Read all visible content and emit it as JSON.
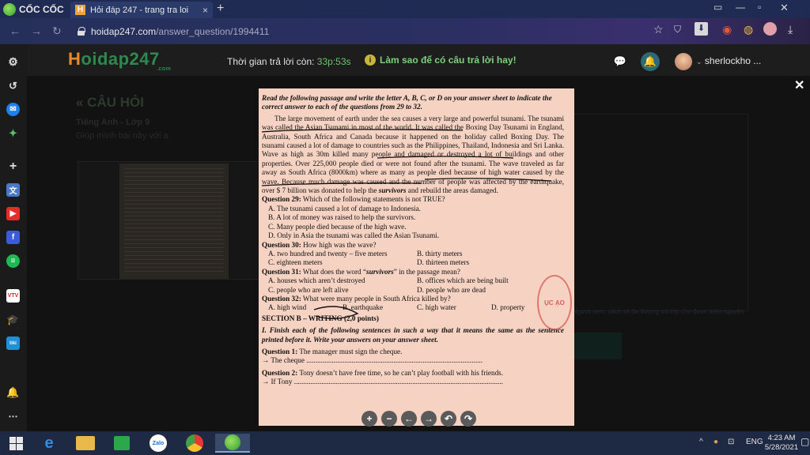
{
  "browser": {
    "brand": "CỐC CỐC",
    "tab_title": "Hỏi đáp 247 - trang tra loi",
    "url_domain": "hoidap247.com",
    "url_path": "/answer_question/1994411"
  },
  "site": {
    "logo_prefix": "H",
    "logo_rest": "oidap247",
    "logo_com": ".com",
    "timer_label": "Thời gian trả lời còn:",
    "timer_value": "33p:53s",
    "tips": "Làm sao để có câu trả lời hay!",
    "username": "sherlockho ..."
  },
  "page": {
    "back_title": "« CÂU HỎI",
    "subject": "Tiếng Anh - Lớp 9",
    "question": "Giúp mình bài này với ạ",
    "faint": "Ngươi xem, cách sẽ đa đường trà lớp cho được kiện nguyên"
  },
  "document": {
    "instruction": "Read the following passage and write the letter A, B, C, or D on your answer sheet to indicate the correct answer to each of the questions from 29 to 32.",
    "passage": [
      "The large movement of earth under the sea causes a very large and powerful tsunami. The tsunami was called the Asian Tsunami in most of the world. It was called the Boxing Day Tsunami in England, Australia, South Africa and Canada because it happened on the holiday called Boxing Day. The tsunami caused a lot of damage to countries such as the Philippines, Thailand, Indonesia and Sri Lanka. Wave as high as 30m killed many people and damaged or destroyed a lot of buildings and other properties. Over 225,000 people died or were not found after the tsunami. The wave traveled as far away as South Africa (8000km) where as many as people died because of high water caused by the wave. Because much damage was caused and the number of people was affected by the earthquake, over $ 7 billion was donated to help the",
      "survivors",
      " and rebuild the areas damaged."
    ],
    "q29": {
      "label": "Question 29:",
      "text": " Which of the following statements is not TRUE?",
      "a": "A. The tsunami caused a lot of damage to Indonesia.",
      "b": "B. A lot of money was raised to help the survivors.",
      "c": "C. Many people died because of the high wave.",
      "d": "D. Only in Asia the tsunami was called the Asian Tsunami."
    },
    "q30": {
      "label": "Question 30:",
      "text": " How high was the wave?",
      "a": "A. two hundred and twenty – five meters",
      "b": "B. thirty meters",
      "c": "C. eighteen meters",
      "d": "D. thirteen meters"
    },
    "q31": {
      "label": "Question 31:",
      "text_pre": " What does the word “",
      "word": "survivors",
      "text_post": "” in the passage mean?",
      "a": "A. houses which aren’t destroyed",
      "b": "B. offices which are being built",
      "c": "C. people who are left alive",
      "d": "D. people who are dead"
    },
    "q32": {
      "label": "Question 32:",
      "text": " What were many people in South Africa killed by?",
      "a": "A. high wind",
      "b": "B. earthquake",
      "c": "C. high water",
      "d": "D. property"
    },
    "section_b": "SECTION B – WRITING (2,0 points)",
    "part1": "I. Finish each of the following sentences in such a way that it means the same as the sentence printed before it. Write your answers on your answer sheet.",
    "w1": {
      "label": "Question 1:",
      "text": " The manager must sign the cheque.",
      "answer": "→ The cheque ................................................................................................."
    },
    "w2": {
      "label": "Question 2:",
      "text": " Tony doesn’t have free time, so he can’t play football with his friends.",
      "answer": "→ If Tony ..................................................................................................................."
    },
    "stamp": "ỤC\nẠO"
  },
  "taskbar": {
    "lang": "ENG",
    "time": "4:23 AM",
    "date": "5/28/2021"
  },
  "colors": {
    "page_bg": "#121212",
    "doc_bg": "#f5d2c2",
    "accent_green": "#6cc36c",
    "logo_orange": "#e8892c"
  },
  "icons": [
    "gear-icon",
    "history-icon",
    "messenger-icon",
    "game-icon",
    "plus-icon",
    "translate-icon",
    "youtube-icon",
    "facebook-icon",
    "spotify-icon",
    "vtv-icon",
    "bell-icon",
    "more-icon"
  ]
}
